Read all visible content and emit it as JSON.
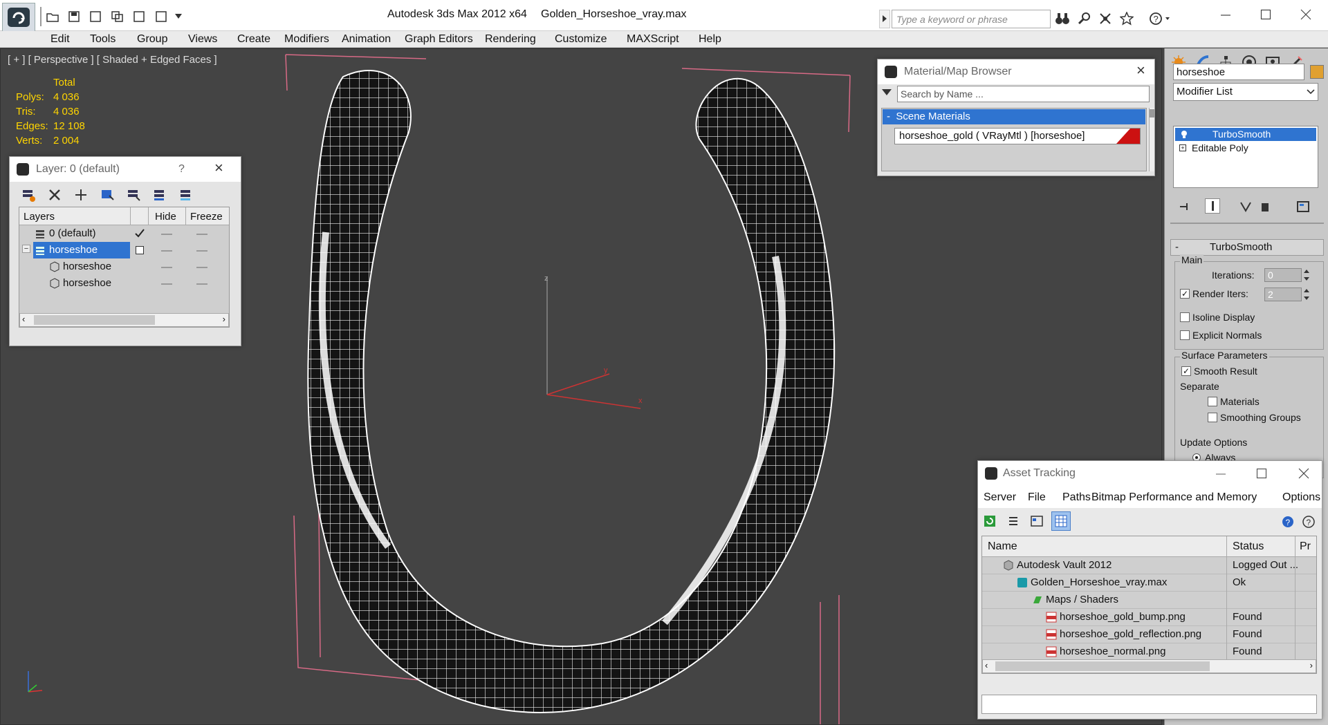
{
  "window": {
    "app_title": "Autodesk 3ds Max  2012 x64",
    "file_title": "Golden_Horseshoe_vray.max",
    "search_placeholder": "Type a keyword or phrase"
  },
  "menu": [
    "Edit",
    "Tools",
    "Group",
    "Views",
    "Create",
    "Modifiers",
    "Animation",
    "Graph Editors",
    "Rendering",
    "Customize",
    "MAXScript",
    "Help"
  ],
  "viewport": {
    "label": "[ + ] [ Perspective ] [ Shaded + Edged Faces ]",
    "stats_header": "Total",
    "stats": [
      {
        "label": "Polys:",
        "value": "4 036"
      },
      {
        "label": "Tris:",
        "value": "4 036"
      },
      {
        "label": "Edges:",
        "value": "12 108"
      },
      {
        "label": "Verts:",
        "value": "2 004"
      }
    ],
    "axis_z": "z",
    "axis_y": "y",
    "axis_x": "x"
  },
  "layer_panel": {
    "title": "Layer: 0 (default)",
    "help": "?",
    "columns": [
      "Layers",
      "Hide",
      "Freeze"
    ],
    "rows": [
      {
        "name": "0 (default)"
      },
      {
        "name": "horseshoe"
      },
      {
        "name": "horseshoe"
      },
      {
        "name": "horseshoe"
      }
    ]
  },
  "material_browser": {
    "title": "Material/Map Browser",
    "search_placeholder": "Search by Name ...",
    "group": "Scene Materials",
    "group_toggle": "-",
    "item": "horseshoe_gold  ( VRayMtl ) [horseshoe]",
    "swatch_color": "#cc1111"
  },
  "command_panel": {
    "object_name": "horseshoe",
    "object_color": "#e0a030",
    "modifier_list": "Modifier List",
    "stack": [
      "TurboSmooth",
      "Editable Poly"
    ],
    "rollout_title": "TurboSmooth",
    "rollout_toggle": "-",
    "main_label": "Main",
    "iterations_label": "Iterations:",
    "iterations_value": "0",
    "render_iters_label": "Render Iters:",
    "render_iters_value": "2",
    "isoline": "Isoline Display",
    "explicit_normals": "Explicit Normals",
    "surface_params": "Surface Parameters",
    "smooth_result": "Smooth Result",
    "separate": "Separate",
    "materials": "Materials",
    "smoothing_groups": "Smoothing Groups",
    "update_options": "Update Options",
    "always": "Always"
  },
  "asset_tracking": {
    "title": "Asset Tracking",
    "menu": [
      "Server",
      "File",
      "Paths",
      "Bitmap Performance and Memory",
      "Options"
    ],
    "columns": [
      "Name",
      "Status",
      "Pr"
    ],
    "rows": [
      {
        "name": "Autodesk Vault 2012",
        "status": "Logged Out ..."
      },
      {
        "name": "Golden_Horseshoe_vray.max",
        "status": "Ok"
      },
      {
        "name": "Maps / Shaders",
        "status": ""
      },
      {
        "name": "horseshoe_gold_bump.png",
        "status": "Found"
      },
      {
        "name": "horseshoe_gold_reflection.png",
        "status": "Found"
      },
      {
        "name": "horseshoe_normal.png",
        "status": "Found"
      }
    ]
  },
  "colors": {
    "selection": "#2f74d0",
    "stats_text": "#ffd500",
    "viewport_bg": "#444444",
    "wire": "#ffffff",
    "bbox": "#d86a86"
  }
}
